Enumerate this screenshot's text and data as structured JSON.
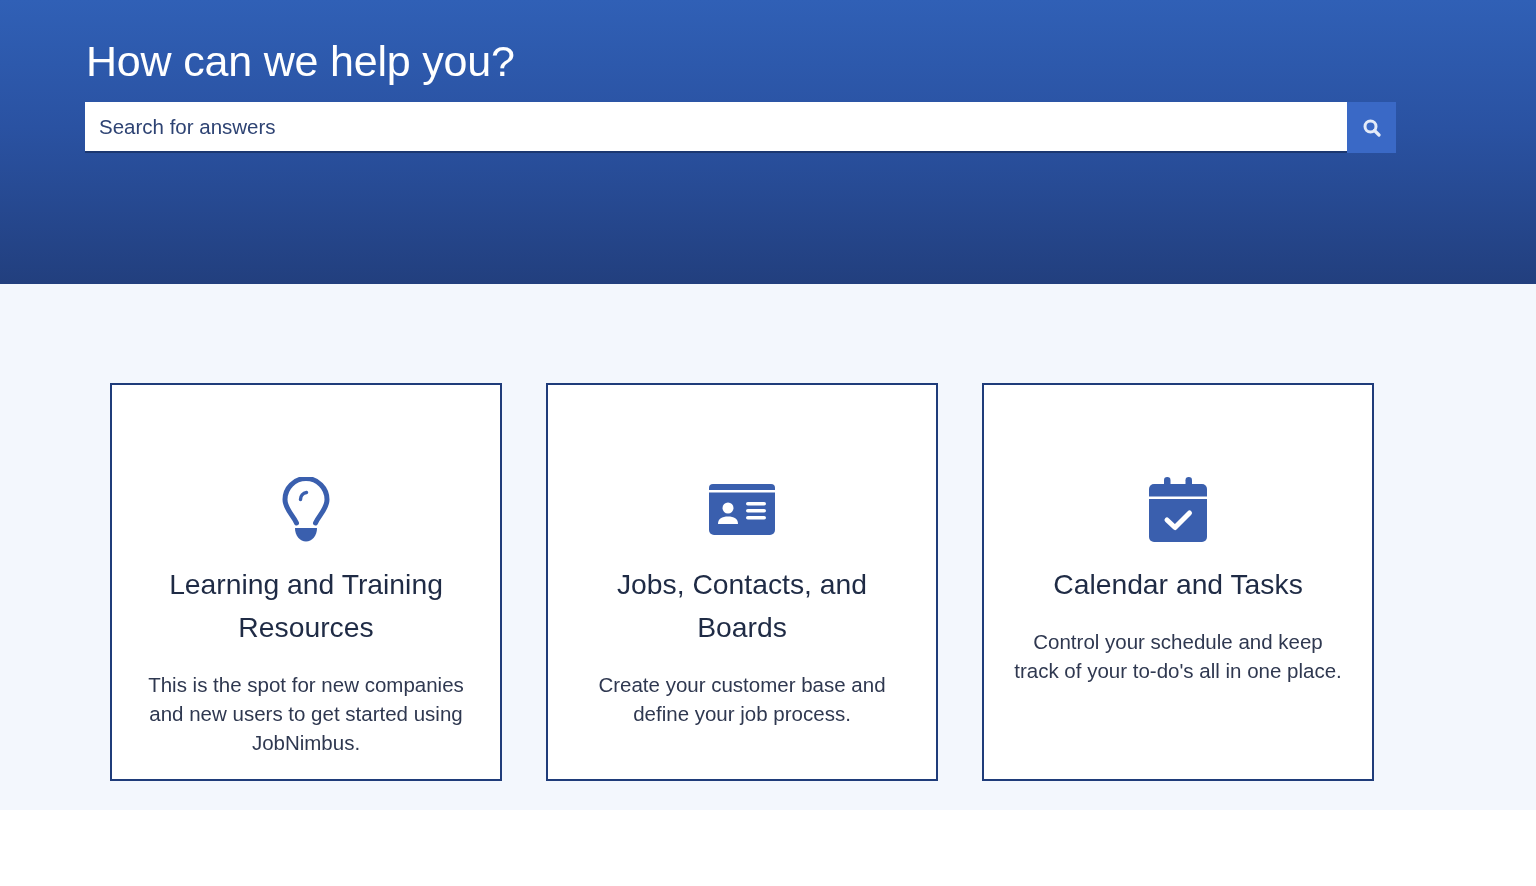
{
  "header": {
    "title": "How can we help you?",
    "search": {
      "placeholder": "Search for answers"
    }
  },
  "cards": [
    {
      "kind": "bulb",
      "title": "Learning and Training Resources",
      "description": "This is the spot for new companies and new users to get started using JobNimbus."
    },
    {
      "kind": "id-card",
      "title": "Jobs, Contacts, and Boards",
      "description": "Create your customer base and define your job process."
    },
    {
      "kind": "calendar",
      "title": "Calendar and Tasks",
      "description": "Control your schedule and keep track of your to-do's all in one place."
    }
  ]
}
